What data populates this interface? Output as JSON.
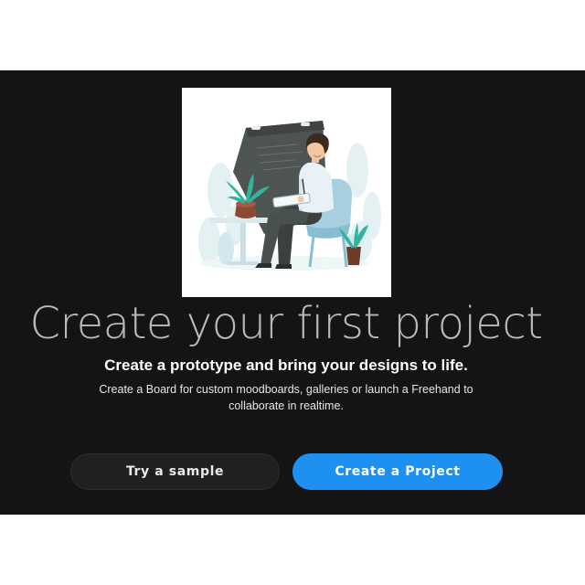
{
  "empty_state": {
    "illustration_icon": "person-at-drawing-board-illustration",
    "title": "Create your first project",
    "subtitle": "Create a prototype and bring your designs to life.",
    "description": "Create a Board for custom moodboards, galleries or launch a Freehand to collaborate in realtime."
  },
  "actions": {
    "secondary_label": "Try a sample",
    "primary_label": "Create a Project"
  },
  "colors": {
    "background_dark": "#141414",
    "primary_button": "#1e90f0",
    "secondary_button": "#202020",
    "title_text": "#b9b9b9"
  }
}
